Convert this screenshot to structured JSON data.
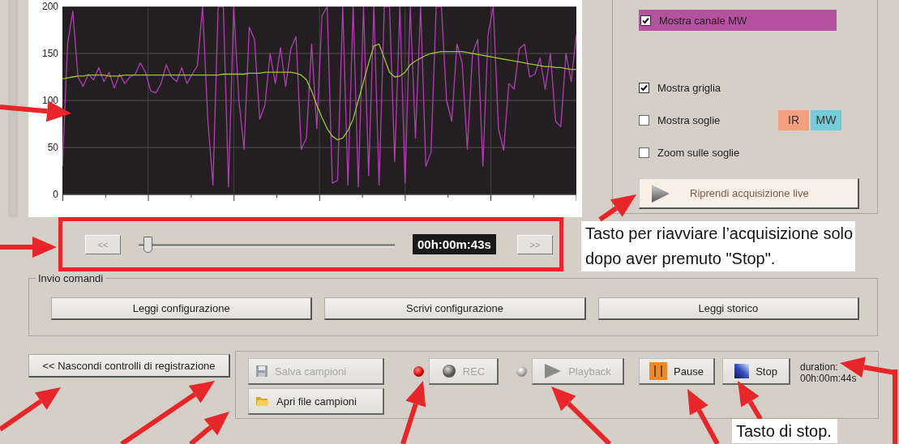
{
  "chart": {
    "chart_data": {
      "type": "line",
      "ylim": [
        0,
        200
      ],
      "yticks": [
        0,
        50,
        100,
        150,
        200
      ],
      "grid": true,
      "series": [
        {
          "color": "#b43cb4",
          "values": [
            30,
            160,
            195,
            125,
            115,
            128,
            122,
            135,
            120,
            130,
            113,
            128,
            118,
            125,
            128,
            140,
            130,
            110,
            108,
            118,
            138,
            125,
            120,
            135,
            118,
            128,
            137,
            200,
            80,
            10,
            200,
            200,
            8,
            200,
            100,
            48,
            178,
            165,
            80,
            95,
            150,
            118,
            156,
            115,
            155,
            168,
            48,
            60,
            160,
            70,
            190,
            200,
            12,
            15,
            200,
            10,
            200,
            8,
            200,
            20,
            200,
            10,
            200,
            200,
            35,
            200,
            12,
            200,
            60,
            200,
            30,
            45,
            200,
            200,
            100,
            78,
            160,
            140,
            48,
            150,
            165,
            30,
            170,
            200,
            70,
            47,
            118,
            112,
            155,
            160,
            125,
            128,
            145,
            112,
            150,
            78,
            72,
            150,
            120,
            170
          ]
        },
        {
          "color": "#9ac830",
          "values": [
            123,
            124,
            125,
            126,
            126,
            127,
            127,
            127,
            127,
            126,
            126,
            126,
            127,
            127,
            127,
            127,
            127,
            127,
            127,
            127,
            127,
            127,
            127,
            127,
            127,
            127,
            127,
            127,
            127,
            127,
            127,
            128,
            128,
            128,
            128,
            128,
            129,
            129,
            129,
            130,
            130,
            130,
            130,
            130,
            130,
            129,
            127,
            122,
            110,
            95,
            82,
            70,
            62,
            58,
            60,
            68,
            80,
            100,
            120,
            140,
            158,
            160,
            145,
            130,
            125,
            126,
            130,
            138,
            142,
            145,
            148,
            150,
            151,
            152,
            152,
            152,
            152,
            152,
            151,
            150,
            149,
            148,
            147,
            146,
            145,
            144,
            143,
            142,
            141,
            140,
            139,
            138,
            137,
            136,
            136,
            135,
            135,
            134,
            133,
            133
          ]
        }
      ]
    }
  },
  "channels": [
    {
      "label": "Mostra canale MW",
      "checked": true,
      "color": "#b452a0"
    }
  ],
  "options": [
    {
      "label": "Mostra griglia",
      "checked": true
    },
    {
      "label": "Mostra soglie",
      "checked": false,
      "tags": [
        {
          "label": "IR",
          "color": "#f4a080"
        },
        {
          "label": "MW",
          "color": "#74ccd8"
        }
      ]
    },
    {
      "label": "Zoom sulle soglie",
      "checked": false
    }
  ],
  "live_button": {
    "label": "Riprendi acquisizione live"
  },
  "timeline": {
    "back": "<<",
    "forward": ">>",
    "level": 0.02,
    "time": "00h:00m:43s"
  },
  "commands": {
    "title": "Invio comandi",
    "buttons": [
      "Leggi configurazione",
      "Scrivi configurazione",
      "Leggi storico"
    ]
  },
  "toggle_button": "<< Nascondi controlli di registrazione",
  "recording": [
    {
      "kind": "save",
      "label": "Salva campioni",
      "disabled": true
    },
    {
      "kind": "open",
      "label": "Apri file campioni",
      "disabled": false
    },
    {
      "kind": "rec",
      "label": "REC",
      "disabled": true,
      "indicator_on": true
    },
    {
      "kind": "playback",
      "label": "Playback",
      "disabled": true,
      "indicator_on": false
    },
    {
      "kind": "pause",
      "label": "Pause",
      "disabled": false
    },
    {
      "kind": "stop",
      "label": "Stop",
      "disabled": false
    }
  ],
  "duration": {
    "label": "duration:",
    "value": "00h:00m:44s"
  },
  "annotations": [
    {
      "text": "Tasto per riavviare l’acquisizione solo dopo aver premuto \"Stop\"."
    },
    {
      "text": "Tasto di stop."
    }
  ]
}
